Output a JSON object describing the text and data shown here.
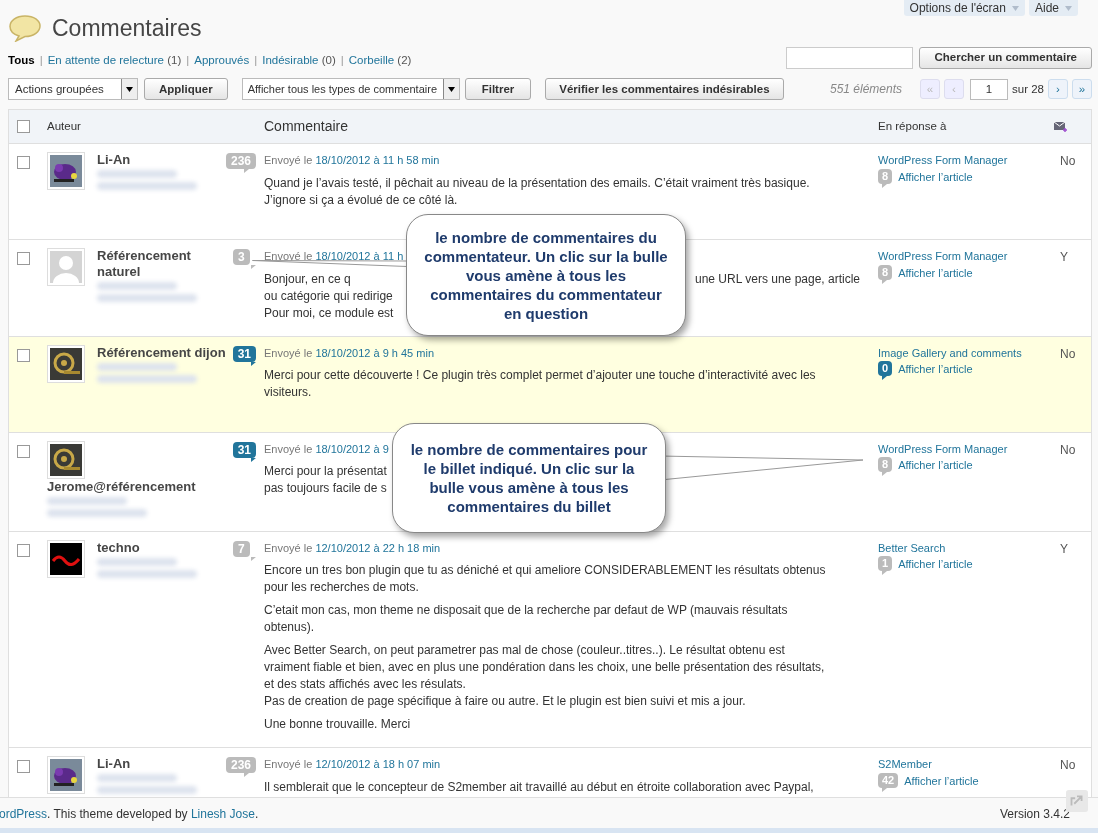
{
  "header": {
    "title": "Commentaires",
    "screen_options": "Options de l'écran",
    "help": "Aide"
  },
  "filters": [
    {
      "label": "Tous",
      "selected": true
    },
    {
      "separator": "|",
      "label": "En attente de relecture",
      "count": "(1)",
      "selected": false
    },
    {
      "separator": "|",
      "label": "Approuvés",
      "selected": false
    },
    {
      "separator": "|",
      "label": "Indésirable",
      "count": "(0)",
      "selected": false
    },
    {
      "separator": "|",
      "label": "Corbeille",
      "count": "(2)",
      "selected": false
    }
  ],
  "search": {
    "button": "Chercher un commentaire"
  },
  "actions": {
    "bulk": "Actions groupées",
    "apply": "Appliquer",
    "type_filter": "Afficher tous les types de commentaire",
    "filter": "Filtrer",
    "check_spam": "Vérifier les commentaires indésirables"
  },
  "pagination": {
    "count": "551 éléments",
    "first": "«",
    "prev": "‹",
    "page": "1",
    "of": "sur 28",
    "next": "›",
    "last": "»"
  },
  "table": {
    "select_all_checked": false,
    "columns": [
      "Auteur",
      "Commentaire",
      "En réponse à"
    ],
    "rows": [
      {
        "checked": false,
        "avatar": {
          "kind": "monster"
        },
        "name": "Li-An",
        "author_count": {
          "text": "236",
          "highlight": false
        },
        "pending": false,
        "date_prefix": "Envoyé le",
        "date": "18/10/2012 à 11 h 58 min",
        "paragraphs": [
          [
            [
              "Quand je l’avais testé, il pêchait au niveau de la présentation des emails. C’était vraiment très basique."
            ],
            [
              "J’ignore si ça a évolué de ce côté là."
            ]
          ]
        ],
        "post": "WordPress Form Manager",
        "post_count": {
          "text": "8",
          "highlight": false
        },
        "view": "Afficher l’article",
        "col5": "No"
      },
      {
        "checked": false,
        "avatar": {
          "kind": "blank"
        },
        "name": "Référencement naturel",
        "author_count": {
          "text": "3",
          "highlight": false
        },
        "pending": false,
        "date_prefix": "Envoyé le",
        "date": "18/10/2012 à 11 h",
        "paragraphs": [
          [
            [
              "Bonjour, en ce q",
              "une URL vers une page, article"
            ],
            [
              "ou catégorie qui redirige"
            ],
            [
              "Pour moi, ce module est"
            ]
          ]
        ],
        "post": "WordPress Form Manager",
        "post_count": {
          "text": "8",
          "highlight": false
        },
        "view": "Afficher l’article",
        "col5": "Y"
      },
      {
        "checked": false,
        "avatar": {
          "kind": "at"
        },
        "name": "Référencement dijon",
        "author_count": {
          "text": "31",
          "highlight": true
        },
        "pending": true,
        "date_prefix": "Envoyé le",
        "date": "18/10/2012 à 9 h 45 min",
        "paragraphs": [
          [
            [
              "Merci pour cette découverte ! Ce plugin très complet permet d’ajouter une touche d’interactivité avec les"
            ],
            [
              "visiteurs."
            ]
          ]
        ],
        "post": "Image Gallery and comments",
        "post_count": {
          "text": "0",
          "highlight": true
        },
        "view": "Afficher l’article",
        "col5": "No"
      },
      {
        "checked": false,
        "avatar": {
          "kind": "at"
        },
        "name": "Jerome@référencement",
        "author_count": {
          "text": "31",
          "highlight": true
        },
        "pending": false,
        "date_prefix": "Envoyé le",
        "date": "18/10/2012 à 9",
        "paragraphs": [
          [
            [
              "Merci pour la présentat"
            ],
            [
              "pas toujours facile de s"
            ]
          ]
        ],
        "post": "WordPress Form Manager",
        "post_count": {
          "text": "8",
          "highlight": false
        },
        "view": "Afficher l’article",
        "col5": "No"
      },
      {
        "checked": false,
        "avatar": {
          "kind": "tech"
        },
        "name": "techno",
        "author_count": {
          "text": "7",
          "highlight": false
        },
        "pending": false,
        "date_prefix": "Envoyé le",
        "date": "12/10/2012 à 22 h 18 min",
        "paragraphs": [
          [
            [
              "Encore un tres bon plugin que tu as déniché et qui ameliore CONSIDERABLEMENT les résultats obtenus"
            ],
            [
              "pour les recherches de mots."
            ]
          ],
          [
            [
              "C’etait mon cas, mon theme ne disposait que de la recherche par defaut de WP (mauvais résultats"
            ],
            [
              "obtenus)."
            ]
          ],
          [
            [
              "Avec Better Search, on peut parametrer pas mal de chose (couleur..titres..). Le résultat obtenu est"
            ],
            [
              "vraiment fiable et bien, avec en plus une pondération dans les choix, une belle présentation des résultats,"
            ],
            [
              "et des stats affichés avec les résulats."
            ],
            [
              "Pas de creation de page spécifique à faire ou autre. Et le plugin est bien suivi et mis a jour."
            ]
          ],
          [
            [
              "Une bonne trouvaille. Merci"
            ]
          ]
        ],
        "post": "Better Search",
        "post_count": {
          "text": "1",
          "highlight": false
        },
        "view": "Afficher l’article",
        "col5": "Y"
      },
      {
        "checked": false,
        "avatar": {
          "kind": "monster"
        },
        "name": "Li-An",
        "author_count": {
          "text": "236",
          "highlight": false
        },
        "pending": false,
        "date_prefix": "Envoyé le",
        "date": "12/10/2012 à 18 h 07 min",
        "paragraphs": [
          [
            [
              "Il semblerait que le concepteur de S2member ait travaillé au début en étroite collaboration avec Paypal,"
            ]
          ]
        ],
        "post": "S2Member",
        "post_count": {
          "text": "42",
          "highlight": false
        },
        "view": "Afficher l’article",
        "col5": "No"
      }
    ]
  },
  "callouts": [
    {
      "text": "le nombre de commentaires du commentateur. Un clic sur la bulle vous amène à tous les commentaires du commentateur en question",
      "kind": "left"
    },
    {
      "text": "le nombre de commentaires pour le billet indiqué. Un clic sur la bulle vous amène à tous les commentaires du billet",
      "kind": "right"
    }
  ],
  "footer": {
    "link": "ordPress",
    "text": ". This theme developed by ",
    "author": "Linesh Jose",
    "end": ".",
    "version": "Version 3.4.2"
  }
}
